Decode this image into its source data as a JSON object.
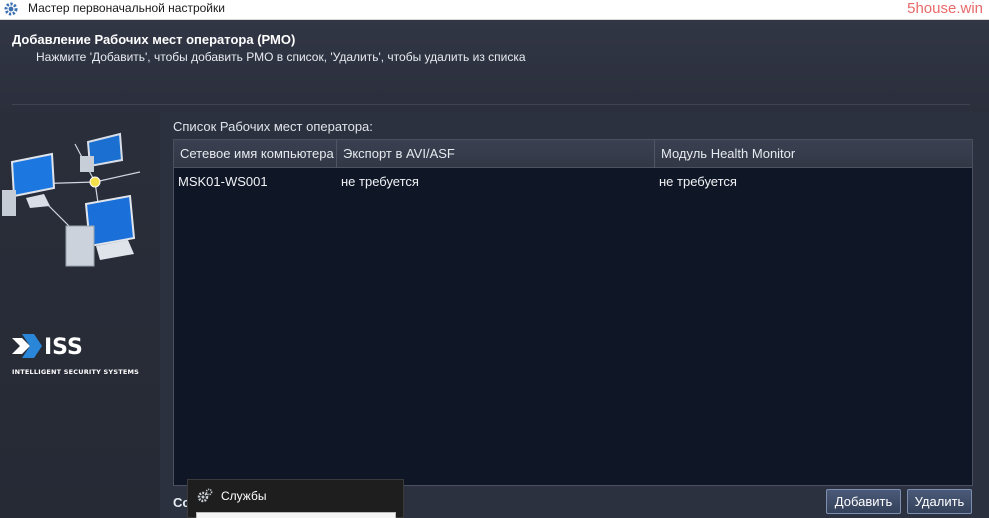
{
  "window": {
    "title": "Мастер первоначальной настройки",
    "watermark": "5house.win"
  },
  "header": {
    "title": "Добавление Рабочих мест оператора (РМО)",
    "subtitle": "Нажмите 'Добавить', чтобы добавить РМО в список, 'Удалить', чтобы удалить из списка"
  },
  "branding": {
    "logo_text": "ISS",
    "tagline": "INTELLIGENT SECURITY SYSTEMS"
  },
  "list": {
    "label": "Список Рабочих мест оператора:",
    "columns": [
      "Сетевое имя компьютера",
      "Экспорт в AVI/ASF",
      "Модуль Health Monitor"
    ],
    "rows": [
      [
        "MSK01-WS001",
        "не требуется",
        "не требуется"
      ]
    ]
  },
  "footer": {
    "partial_label": "Со",
    "add_label": "Добавить",
    "remove_label": "Удалить"
  },
  "overlay_window": {
    "title": "Службы",
    "icon": "gear-icon"
  },
  "colors": {
    "background": "#2c3140",
    "table_background": "#0f1626",
    "button": "#3f4d68"
  }
}
